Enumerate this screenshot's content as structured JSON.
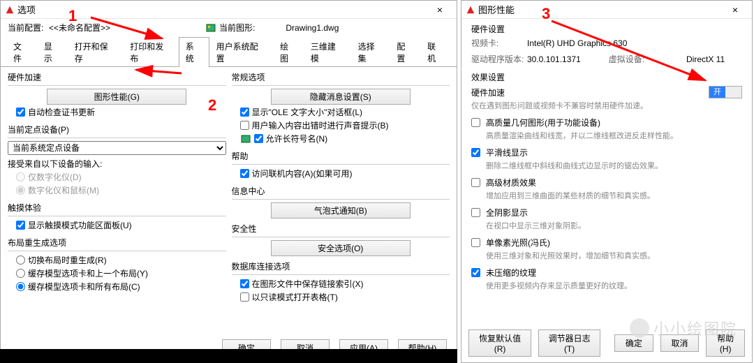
{
  "numbers": {
    "n1": "1",
    "n2": "2",
    "n3": "3"
  },
  "left": {
    "title": "选项",
    "config_label": "当前配置:",
    "config_value": "<<未命名配置>>",
    "drawing_label": "当前图形:",
    "drawing_value": "Drawing1.dwg",
    "tabs": [
      "文件",
      "显示",
      "打开和保存",
      "打印和发布",
      "系统",
      "用户系统配置",
      "绘图",
      "三维建模",
      "选择集",
      "配置",
      "联机"
    ],
    "active_tab": 4,
    "hw_accel": {
      "title": "硬件加速",
      "btn": "图形性能(G)",
      "auto_check": "自动检查证书更新"
    },
    "point_device": {
      "title": "当前定点设备(P)",
      "select_value": "当前系统定点设备",
      "accept_label": "接受来自以下设备的输入:",
      "opt1": "仅数字化仪(D)",
      "opt2": "数字化仪和鼠标(M)"
    },
    "touch": {
      "title": "触摸体验",
      "show_panel": "显示触摸模式功能区面板(U)"
    },
    "layout_regen": {
      "title": "布局重生成选项",
      "opt1": "切换布局时重生成(R)",
      "opt2": "缓存模型选项卡和上一个布局(Y)",
      "opt3": "缓存模型选项卡和所有布局(C)"
    },
    "general": {
      "title": "常规选项",
      "btn": "隐藏消息设置(S)",
      "ole": "显示\"OLE 文字大小\"对话框(L)",
      "user_input": "用户输入内容出错时进行声音提示(B)",
      "long_name": "允许长符号名(N)"
    },
    "help": {
      "title": "帮助",
      "online": "访问联机内容(A)(如果可用)"
    },
    "info_center": {
      "title": "信息中心",
      "btn": "气泡式通知(B)"
    },
    "security": {
      "title": "安全性",
      "btn": "安全选项(O)"
    },
    "db_link": {
      "title": "数据库连接选项",
      "save_index": "在图形文件中保存链接索引(X)",
      "readonly": "以只读模式打开表格(T)"
    },
    "footer": {
      "ok": "确定",
      "cancel": "取消",
      "apply": "应用(A)",
      "help": "帮助(H)"
    }
  },
  "right": {
    "title": "图形性能",
    "hw_section": "硬件设置",
    "gpu_label": "视频卡:",
    "gpu_value": "Intel(R) UHD Graphics 630",
    "drv_label": "驱动程序版本:",
    "drv_value": "30.0.101.1371",
    "vd_label": "虚拟设备:",
    "vd_value": "DirectX 11",
    "effects_section": "效果设置",
    "accel_label": "硬件加速",
    "toggle_on": "开",
    "accel_desc": "仅在遇到图形问题或视频卡不兼容时禁用硬件加速。",
    "opts": [
      {
        "checked": false,
        "title": "高质量几何图形(用于功能设备)",
        "desc": "高质量渲染曲线和线宽，并以二维线框改进反走样性能。"
      },
      {
        "checked": true,
        "title": "平滑线显示",
        "desc": "删除二维线框中斜线和曲线式边显示时的锯齿效果。"
      },
      {
        "checked": false,
        "title": "高级材质效果",
        "desc": "增加应用到三维曲面的某些材质的细节和真实感。"
      },
      {
        "checked": false,
        "title": "全阴影显示",
        "desc": "在视口中显示三维对象阴影。"
      },
      {
        "checked": false,
        "title": "单像素光照(冯氏)",
        "desc": "使用三维对象和光照效果时，增加细节和真实感。"
      },
      {
        "checked": true,
        "title": "未压缩的纹理",
        "desc": "使用更多视频内存来显示质量更好的纹理。"
      }
    ],
    "footer": {
      "restore": "恢复默认值(R)",
      "tuner_log": "调节器日志(T)",
      "ok": "确定",
      "cancel": "取消",
      "help": "帮助(H)"
    }
  },
  "watermark": "小小绘图院"
}
